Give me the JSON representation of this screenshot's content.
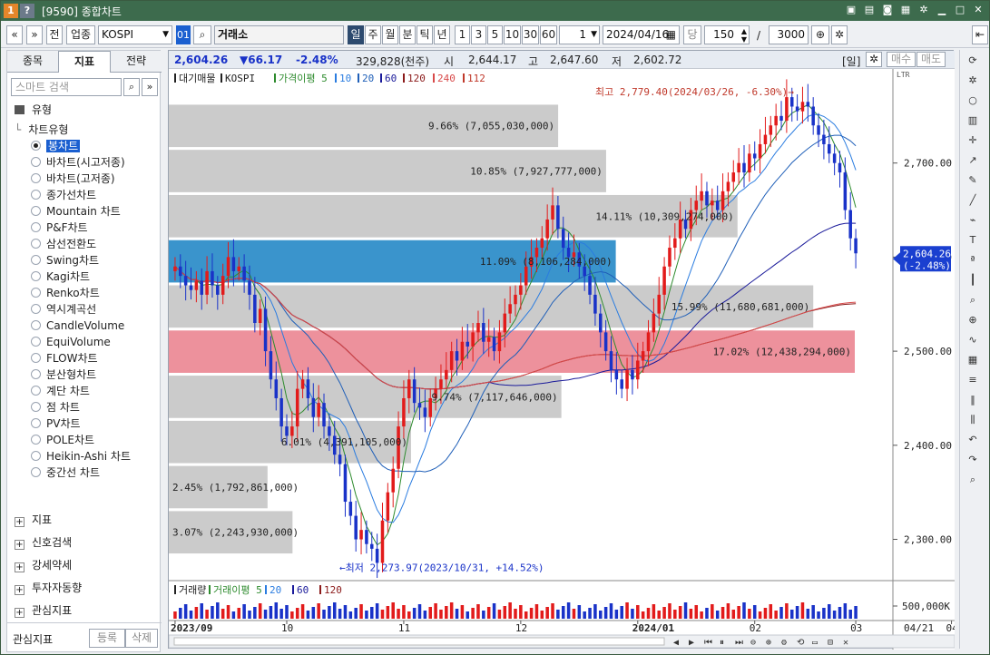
{
  "window": {
    "badge1": "1",
    "badge2": "?",
    "title": "[9590] 종합차트"
  },
  "toolbar": {
    "nav_back": "«",
    "nav_down": "»",
    "btn_all": "전",
    "btn_sector": "업종",
    "symbol": "KOSPI",
    "code_badge": "01",
    "exchange": "거래소",
    "periods": [
      "일",
      "주",
      "월",
      "분",
      "틱",
      "년"
    ],
    "counts": [
      "1",
      "3",
      "5",
      "10",
      "30",
      "60"
    ],
    "unit_value": "1",
    "date": "2024/04/16",
    "date_label": "당",
    "bars_value": "150",
    "slash": "/",
    "max_bars": "3000"
  },
  "left_panel": {
    "tabs": [
      "종목",
      "지표",
      "전략"
    ],
    "search_placeholder": "스마트 검색",
    "type_header": "유형",
    "chart_type_header": "차트유형",
    "chart_types": [
      "봉차트",
      "바차트(시고저종)",
      "바차트(고저종)",
      "종가선차트",
      "Mountain 차트",
      "P&F차트",
      "삼선전환도",
      "Swing차트",
      "Kagi차트",
      "Renko차트",
      "역시계곡선",
      "CandleVolume",
      "EquiVolume",
      "FLOW차트",
      "분산형차트",
      "계단 차트",
      "점 차트",
      "PV차트",
      "POLE차트",
      "Heikin-Ashi 차트",
      "중간선 차트"
    ],
    "sections": [
      "지표",
      "신호검색",
      "강세약세",
      "투자자동향",
      "관심지표"
    ],
    "bottom_label": "관심지표",
    "btn_register": "등록",
    "btn_delete": "삭제"
  },
  "infobar": {
    "price": "2,604.26",
    "change": "▼66.17",
    "pct": "-2.48%",
    "volume": "329,828(천주)",
    "open_label": "시",
    "open": "2,644.17",
    "high_label": "고",
    "high": "2,647.60",
    "low_label": "저",
    "low": "2,602.72",
    "period_badge": "[일]",
    "buy": "매수",
    "sell": "매도"
  },
  "colors": {
    "up": "#e21b1b",
    "down": "#1932c8",
    "accent": "#2d4a6e",
    "profile_blue": "#2f8ec9",
    "profile_pink": "#ec8b97"
  },
  "chart_data": {
    "type": "candlestick",
    "legend": [
      "대기매물",
      "KOSPI",
      "가격이평 5",
      "10",
      "20",
      "60",
      "120",
      "240",
      "112"
    ],
    "ylim": [
      2260,
      2800
    ],
    "y_ticks": [
      2300,
      2400,
      2500,
      2600,
      2700
    ],
    "y_tick_labels": [
      "2,300.00",
      "2,400.00",
      "2,500.00",
      "2,600.00",
      "2,700.00"
    ],
    "x_labels": [
      "2023/09",
      "10",
      "11",
      "12",
      "2024/01",
      "02",
      "03",
      "04"
    ],
    "x_label_at_index": [
      0,
      21,
      43,
      65,
      87,
      109,
      128,
      146
    ],
    "last_price_label": "2,604.26",
    "last_pct_label": "(-2.48%)",
    "high_annotation": "최고 2,779.40(2024/03/26, -6.30%)→",
    "low_annotation": "←최저 2,273.97(2023/10/31, +14.52%)",
    "volume_profile": [
      {
        "label": "3.07% (2,243,930,000)",
        "low": 2285,
        "high": 2330,
        "pct": 3.07
      },
      {
        "label": "2.45% (1,792,861,000)",
        "low": 2333,
        "high": 2378,
        "pct": 2.45
      },
      {
        "label": "6.01% (4,391,105,000)",
        "low": 2381,
        "high": 2426,
        "pct": 6.01
      },
      {
        "label": "9.74% (7,117,646,000)",
        "low": 2429,
        "high": 2474,
        "pct": 9.74
      },
      {
        "label": "17.02% (12,438,294,000)",
        "low": 2477,
        "high": 2522,
        "pct": 17.02,
        "highlight": "pink"
      },
      {
        "label": "15.99% (11,680,681,000)",
        "low": 2525,
        "high": 2570,
        "pct": 15.99
      },
      {
        "label": "11.09% (8,106,284,000)",
        "low": 2573,
        "high": 2618,
        "pct": 11.09,
        "highlight": "blue"
      },
      {
        "label": "14.11% (10,309,274,000)",
        "low": 2621,
        "high": 2666,
        "pct": 14.11
      },
      {
        "label": "10.85% (7,927,777,000)",
        "low": 2669,
        "high": 2714,
        "pct": 10.85
      },
      {
        "label": "9.66% (7,055,030,000)",
        "low": 2717,
        "high": 2762,
        "pct": 9.66
      }
    ],
    "close": [
      2590,
      2580,
      2570,
      2565,
      2575,
      2560,
      2585,
      2570,
      2560,
      2580,
      2600,
      2585,
      2590,
      2575,
      2560,
      2530,
      2545,
      2500,
      2470,
      2450,
      2420,
      2410,
      2420,
      2460,
      2470,
      2450,
      2430,
      2445,
      2420,
      2410,
      2390,
      2380,
      2340,
      2325,
      2300,
      2310,
      2295,
      2290,
      2275,
      2320,
      2350,
      2375,
      2420,
      2450,
      2470,
      2445,
      2440,
      2430,
      2450,
      2460,
      2470,
      2480,
      2500,
      2490,
      2510,
      2505,
      2520,
      2530,
      2510,
      2515,
      2500,
      2520,
      2540,
      2550,
      2560,
      2570,
      2590,
      2600,
      2610,
      2620,
      2640,
      2655,
      2630,
      2610,
      2600,
      2605,
      2590,
      2580,
      2560,
      2540,
      2520,
      2500,
      2480,
      2470,
      2460,
      2480,
      2470,
      2490,
      2500,
      2520,
      2540,
      2560,
      2590,
      2610,
      2620,
      2640,
      2630,
      2650,
      2660,
      2670,
      2655,
      2660,
      2650,
      2670,
      2680,
      2690,
      2700,
      2690,
      2710,
      2705,
      2720,
      2730,
      2740,
      2750,
      2745,
      2770,
      2760,
      2755,
      2765,
      2760,
      2740,
      2730,
      2720,
      2710,
      2700,
      2690,
      2650,
      2620,
      2604
    ]
  },
  "volume_chart": {
    "legend": [
      "거래량",
      "거래이평 5",
      "20",
      "60",
      "120"
    ],
    "tick_label": "500,000K",
    "date_label": "04/21"
  }
}
